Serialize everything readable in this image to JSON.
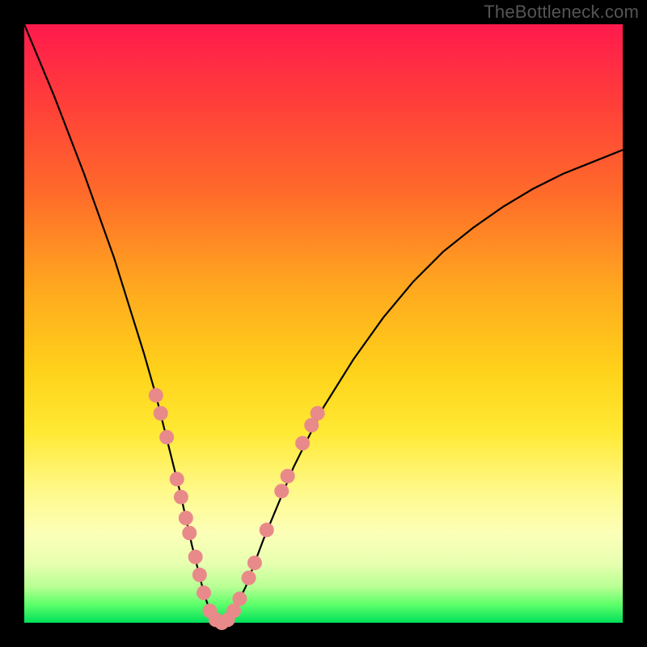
{
  "watermark": "TheBottleneck.com",
  "chart_data": {
    "type": "line",
    "title": "",
    "xlabel": "",
    "ylabel": "",
    "xlim": [
      0,
      100
    ],
    "ylim": [
      0,
      100
    ],
    "series": [
      {
        "name": "curve",
        "x": [
          0,
          5,
          10,
          15,
          20,
          22,
          24,
          26,
          28,
          30,
          31,
          32,
          33,
          34,
          35,
          37,
          40,
          45,
          50,
          55,
          60,
          65,
          70,
          75,
          80,
          85,
          90,
          95,
          100
        ],
        "y": [
          100,
          88,
          75,
          61,
          45,
          38,
          30,
          22,
          13,
          5,
          2,
          0.5,
          0,
          0.5,
          2,
          6,
          14,
          26,
          36,
          44,
          51,
          57,
          62,
          66,
          69.5,
          72.5,
          75,
          77,
          79
        ]
      }
    ],
    "markers": {
      "name": "highlight-dots",
      "color": "#e98a8a",
      "points": [
        {
          "x": 22.0,
          "y": 38
        },
        {
          "x": 22.8,
          "y": 35
        },
        {
          "x": 23.8,
          "y": 31
        },
        {
          "x": 25.5,
          "y": 24
        },
        {
          "x": 26.2,
          "y": 21
        },
        {
          "x": 27.0,
          "y": 17.5
        },
        {
          "x": 27.6,
          "y": 15
        },
        {
          "x": 28.6,
          "y": 11
        },
        {
          "x": 29.3,
          "y": 8
        },
        {
          "x": 30.0,
          "y": 5
        },
        {
          "x": 31.0,
          "y": 2
        },
        {
          "x": 32.0,
          "y": 0.5
        },
        {
          "x": 33.0,
          "y": 0
        },
        {
          "x": 34.0,
          "y": 0.5
        },
        {
          "x": 35.0,
          "y": 2
        },
        {
          "x": 36.0,
          "y": 4
        },
        {
          "x": 37.5,
          "y": 7.5
        },
        {
          "x": 38.5,
          "y": 10
        },
        {
          "x": 40.5,
          "y": 15.5
        },
        {
          "x": 43.0,
          "y": 22
        },
        {
          "x": 44.0,
          "y": 24.5
        },
        {
          "x": 46.5,
          "y": 30
        },
        {
          "x": 48.0,
          "y": 33
        },
        {
          "x": 49.0,
          "y": 35
        }
      ]
    }
  }
}
